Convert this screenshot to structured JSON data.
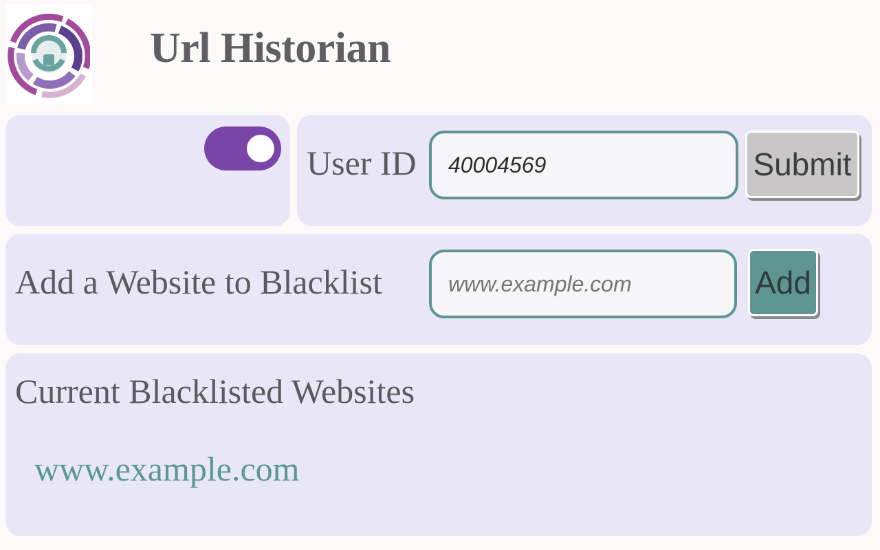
{
  "app": {
    "title": "Url Historian",
    "logo_icon": "circular-logo-icon"
  },
  "toggle": {
    "state": "on",
    "color": "#7a45a8"
  },
  "user": {
    "label": "User ID",
    "value": "40004569",
    "submit_label": "Submit"
  },
  "blacklist_add": {
    "label": "Add a Website to Blacklist",
    "placeholder": "www.example.com",
    "add_label": "Add"
  },
  "blacklist": {
    "heading": "Current Blacklisted Websites",
    "items": [
      "www.example.com"
    ]
  },
  "colors": {
    "accent": "#5e9593",
    "panel": "#e9e7f7",
    "toggle": "#7a45a8"
  }
}
